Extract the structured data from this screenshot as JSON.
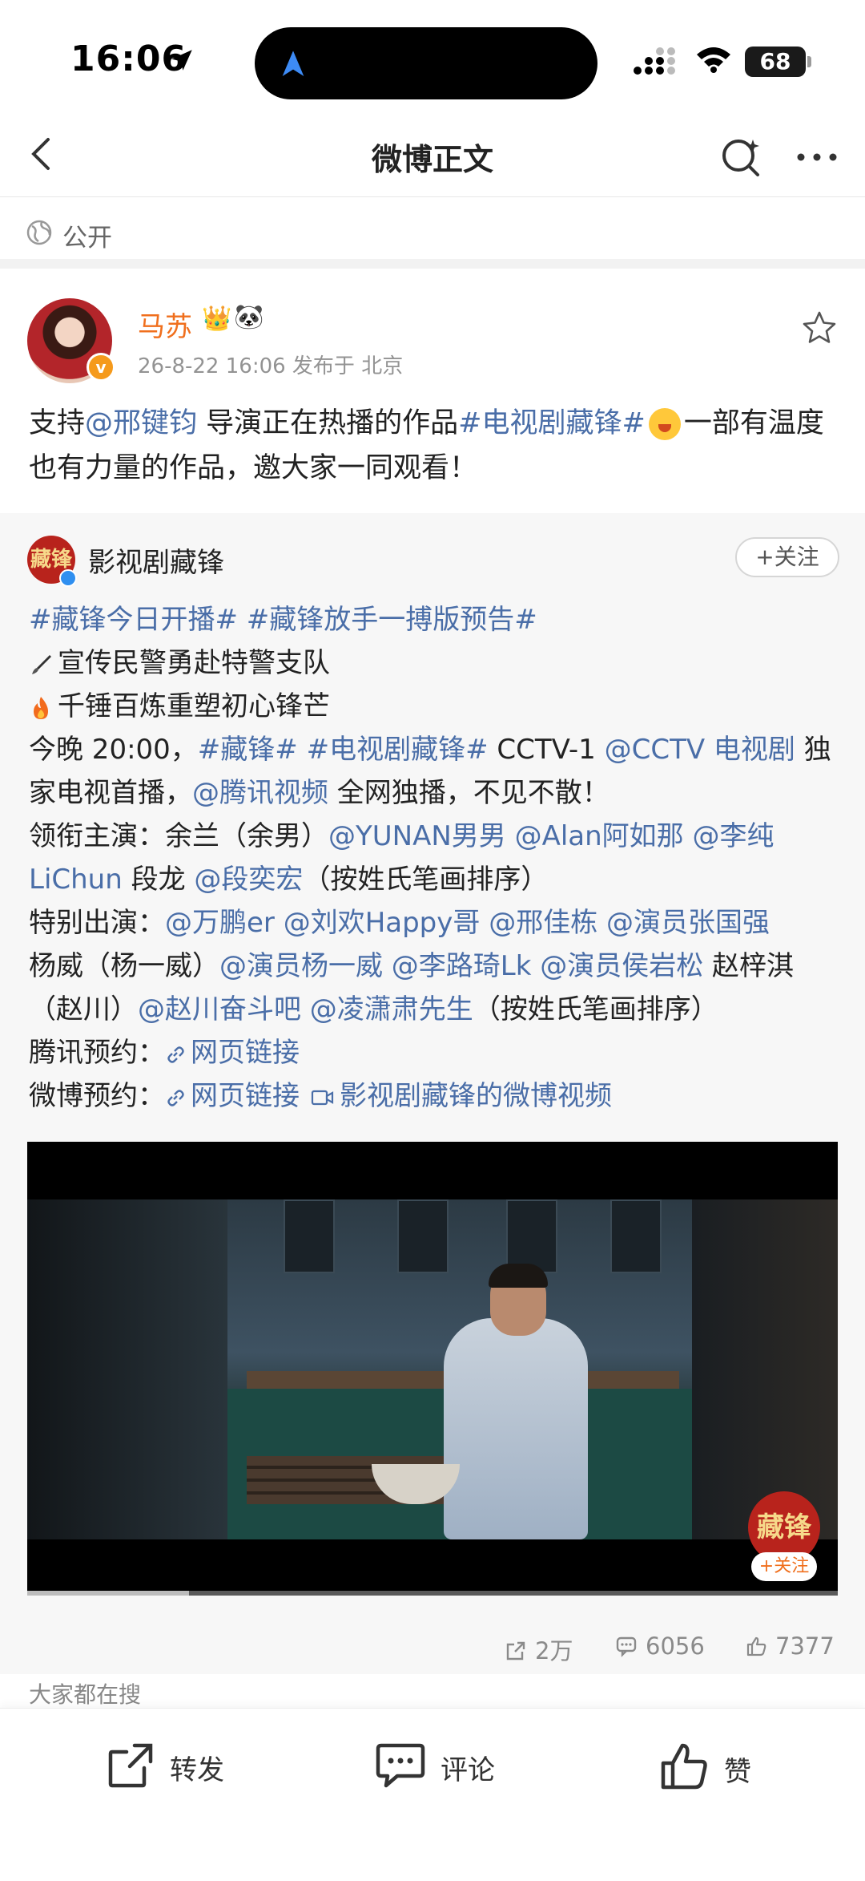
{
  "status_bar": {
    "time": "16:06",
    "battery": "68"
  },
  "nav": {
    "title": "微博正文"
  },
  "visibility": {
    "label": "公开"
  },
  "post": {
    "author": "马苏",
    "meta": "26-8-22 16:06  发布于 北京",
    "text_1": "支持",
    "mention_1": "@邢键钧",
    "text_2": " 导演正在热播的作品",
    "hashtag_1": "#电视剧藏锋#",
    "text_3": "一部有温度也有力量的作品，邀大家一同观看！"
  },
  "repost": {
    "channel_name": "影视剧藏锋",
    "channel_logo": "藏锋",
    "follow_label": "+关注",
    "line_1": "#藏锋今日开播# #藏锋放手一搏版预告#",
    "line_2": "宣传民警勇赴特警支队",
    "line_3": "千锤百炼重塑初心锋芒",
    "line_4a": "今晚 20:00，",
    "line_4b": "#藏锋# #电视剧藏锋#",
    "line_4c": " CCTV-1 ",
    "line_4d": "@CCTV 电视剧",
    "line_4e": " 独",
    "line_5a": "家电视首播，",
    "line_5b": "@腾讯视频",
    "line_5c": " 全网独播，不见不散！",
    "line_6a": "领衔主演：余兰（余男）",
    "line_6b": "@YUNAN男男 @Alan阿如那 @李纯",
    "line_7a": "LiChun",
    "line_7b": " 段龙 ",
    "line_7c": "@段奕宏",
    "line_7d": "（按姓氏笔画排序）",
    "line_8a": "特别出演：",
    "line_8b": "@万鹏er @刘欢Happy哥 @邢佳栋 @演员张国强",
    "line_9a": "杨威（杨一威）",
    "line_9b": "@演员杨一威 @李路琦Lk @演员侯岩松",
    "line_9c": " 赵梓淇",
    "line_10a": "（赵川）",
    "line_10b": "@赵川奋斗吧 @凌潇肃先生",
    "line_10c": "（按姓氏笔画排序）",
    "line_11a": "腾讯预约：",
    "line_11b": "网页链接",
    "line_12a": "微博预约：",
    "line_12b": "网页链接",
    "line_12c": "影视剧藏锋的微博视频",
    "video_watermark": "藏锋",
    "video_follow": "+关注",
    "video_progress": 0.2
  },
  "stats": {
    "reposts": "2万",
    "comments": "6056",
    "likes": "7377"
  },
  "trending_label": "大家都在搜",
  "actions": {
    "repost": "转发",
    "comment": "评论",
    "like": "赞"
  },
  "colors": {
    "link": "#4a6ea8",
    "author": "#f06f1d",
    "brand_red": "#b8231c"
  }
}
